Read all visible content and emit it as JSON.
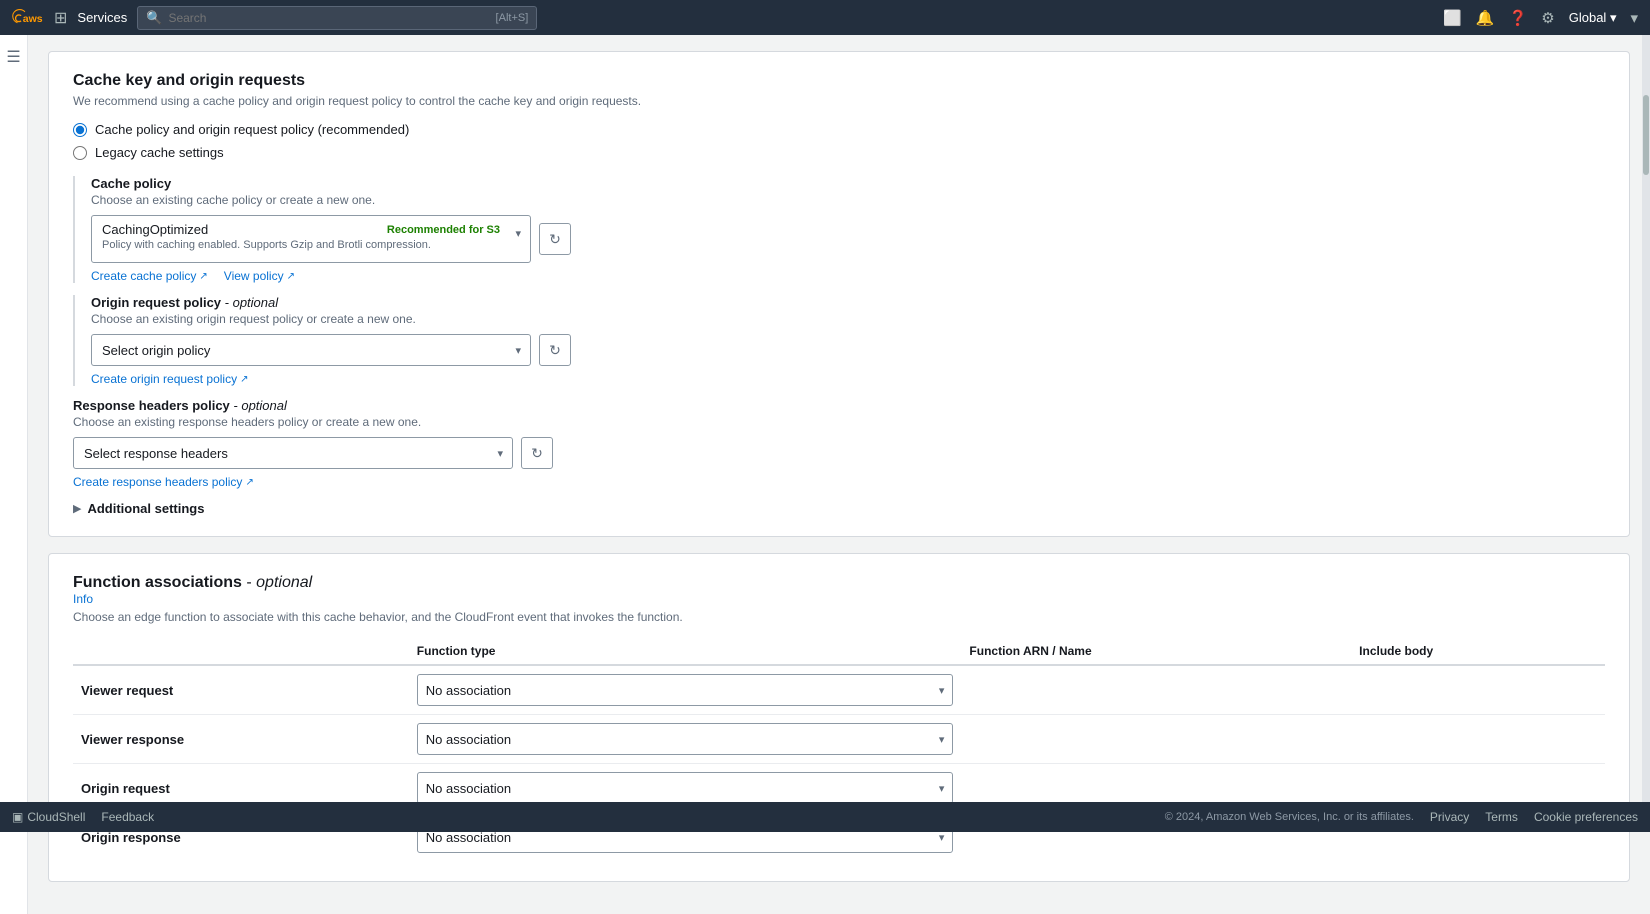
{
  "topnav": {
    "services_label": "Services",
    "search_placeholder": "Search",
    "search_shortcut": "[Alt+S]",
    "region_label": "Global",
    "region_arrow": "▾"
  },
  "page": {
    "cache_section": {
      "title": "Cache key and origin requests",
      "description": "We recommend using a cache policy and origin request policy to control the cache key and origin requests.",
      "radio_recommended": "Cache policy and origin request policy (recommended)",
      "radio_legacy": "Legacy cache settings",
      "cache_policy": {
        "label": "Cache policy",
        "description": "Choose an existing cache policy or create a new one.",
        "selected_value": "CachingOptimized",
        "badge": "Recommended for S3",
        "policy_desc": "Policy with caching enabled. Supports Gzip and Brotli compression.",
        "create_link": "Create cache policy",
        "view_link": "View policy"
      },
      "origin_policy": {
        "label": "Origin request policy",
        "label_optional": " - optional",
        "description": "Choose an existing origin request policy or create a new one.",
        "placeholder": "Select origin policy",
        "create_link": "Create origin request policy"
      },
      "response_headers": {
        "label": "Response headers policy",
        "label_optional": " - optional",
        "description": "Choose an existing response headers policy or create a new one.",
        "placeholder": "Select response headers",
        "create_link": "Create response headers policy"
      },
      "additional_settings": "Additional settings"
    },
    "function_section": {
      "title": "Function associations",
      "title_suffix": " - ",
      "title_optional": "optional",
      "info_link": "Info",
      "description": "Choose an edge function to associate with this cache behavior, and the CloudFront event that invokes the function.",
      "table": {
        "col_function_type": "Function type",
        "col_arn_name": "Function ARN / Name",
        "col_include_body": "Include body",
        "rows": [
          {
            "label": "Viewer request",
            "function_type": "No association"
          },
          {
            "label": "Viewer response",
            "function_type": "No association"
          },
          {
            "label": "Origin request",
            "function_type": "No association"
          },
          {
            "label": "Origin response",
            "function_type": "No association"
          }
        ]
      }
    }
  },
  "bottom": {
    "cloudshell_label": "CloudShell",
    "feedback_label": "Feedback",
    "copyright": "© 2024, Amazon Web Services, Inc. or its affiliates.",
    "privacy_link": "Privacy",
    "terms_link": "Terms",
    "cookie_link": "Cookie preferences"
  }
}
